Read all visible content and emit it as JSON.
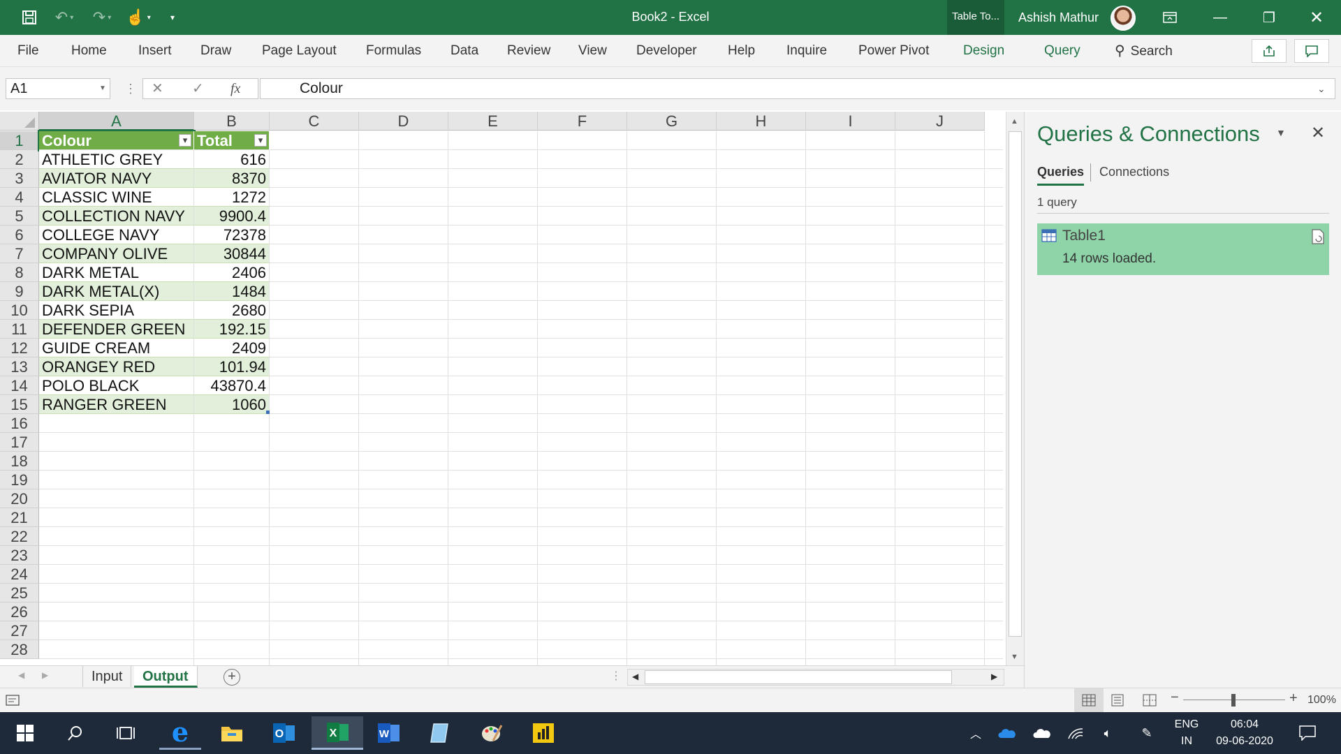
{
  "window": {
    "title": "Book2  -  Excel",
    "contextual_tab": "Table To...",
    "user": "Ashish Mathur"
  },
  "ribbon": {
    "tabs": [
      "File",
      "Home",
      "Insert",
      "Draw",
      "Page Layout",
      "Formulas",
      "Data",
      "Review",
      "View",
      "Developer",
      "Help",
      "Inquire",
      "Power Pivot",
      "Design",
      "Query"
    ],
    "search_label": "Search"
  },
  "formula_bar": {
    "name_box": "A1",
    "fx_label": "fx",
    "formula": "Colour"
  },
  "sheet": {
    "columns": [
      "A",
      "B",
      "C",
      "D",
      "E",
      "F",
      "G",
      "H",
      "I",
      "J"
    ],
    "rows": [
      "1",
      "2",
      "3",
      "4",
      "5",
      "6",
      "7",
      "8",
      "9",
      "10",
      "11",
      "12",
      "13",
      "14",
      "15",
      "16",
      "17",
      "18",
      "19",
      "20",
      "21",
      "22",
      "23",
      "24",
      "25",
      "26",
      "27",
      "28"
    ],
    "table_headers": [
      "Colour",
      "Total"
    ],
    "table_rows": [
      [
        "ATHLETIC GREY",
        "616"
      ],
      [
        "AVIATOR NAVY",
        "8370"
      ],
      [
        "CLASSIC WINE",
        "1272"
      ],
      [
        "COLLECTION NAVY",
        "9900.4"
      ],
      [
        "COLLEGE NAVY",
        "72378"
      ],
      [
        "COMPANY OLIVE",
        "30844"
      ],
      [
        "DARK METAL",
        "2406"
      ],
      [
        "DARK METAL(X)",
        "1484"
      ],
      [
        "DARK SEPIA",
        "2680"
      ],
      [
        "DEFENDER GREEN",
        "192.15"
      ],
      [
        "GUIDE CREAM",
        "2409"
      ],
      [
        "ORANGEY RED",
        "101.94"
      ],
      [
        "POLO BLACK",
        "43870.4"
      ],
      [
        "RANGER GREEN",
        "1060"
      ]
    ],
    "header_color": "#70ad47",
    "band_color": "#e2efda"
  },
  "sheet_tabs": {
    "tabs": [
      "Input",
      "Output"
    ],
    "active": "Output"
  },
  "pane": {
    "title": "Queries & Connections",
    "tabs": [
      "Queries",
      "Connections"
    ],
    "count": "1 query",
    "query_name": "Table1",
    "query_status": "14 rows loaded."
  },
  "status": {
    "zoom": "100%"
  },
  "taskbar": {
    "lang_top": "ENG",
    "lang_bottom": "IN",
    "time": "06:04",
    "date": "09-06-2020"
  }
}
